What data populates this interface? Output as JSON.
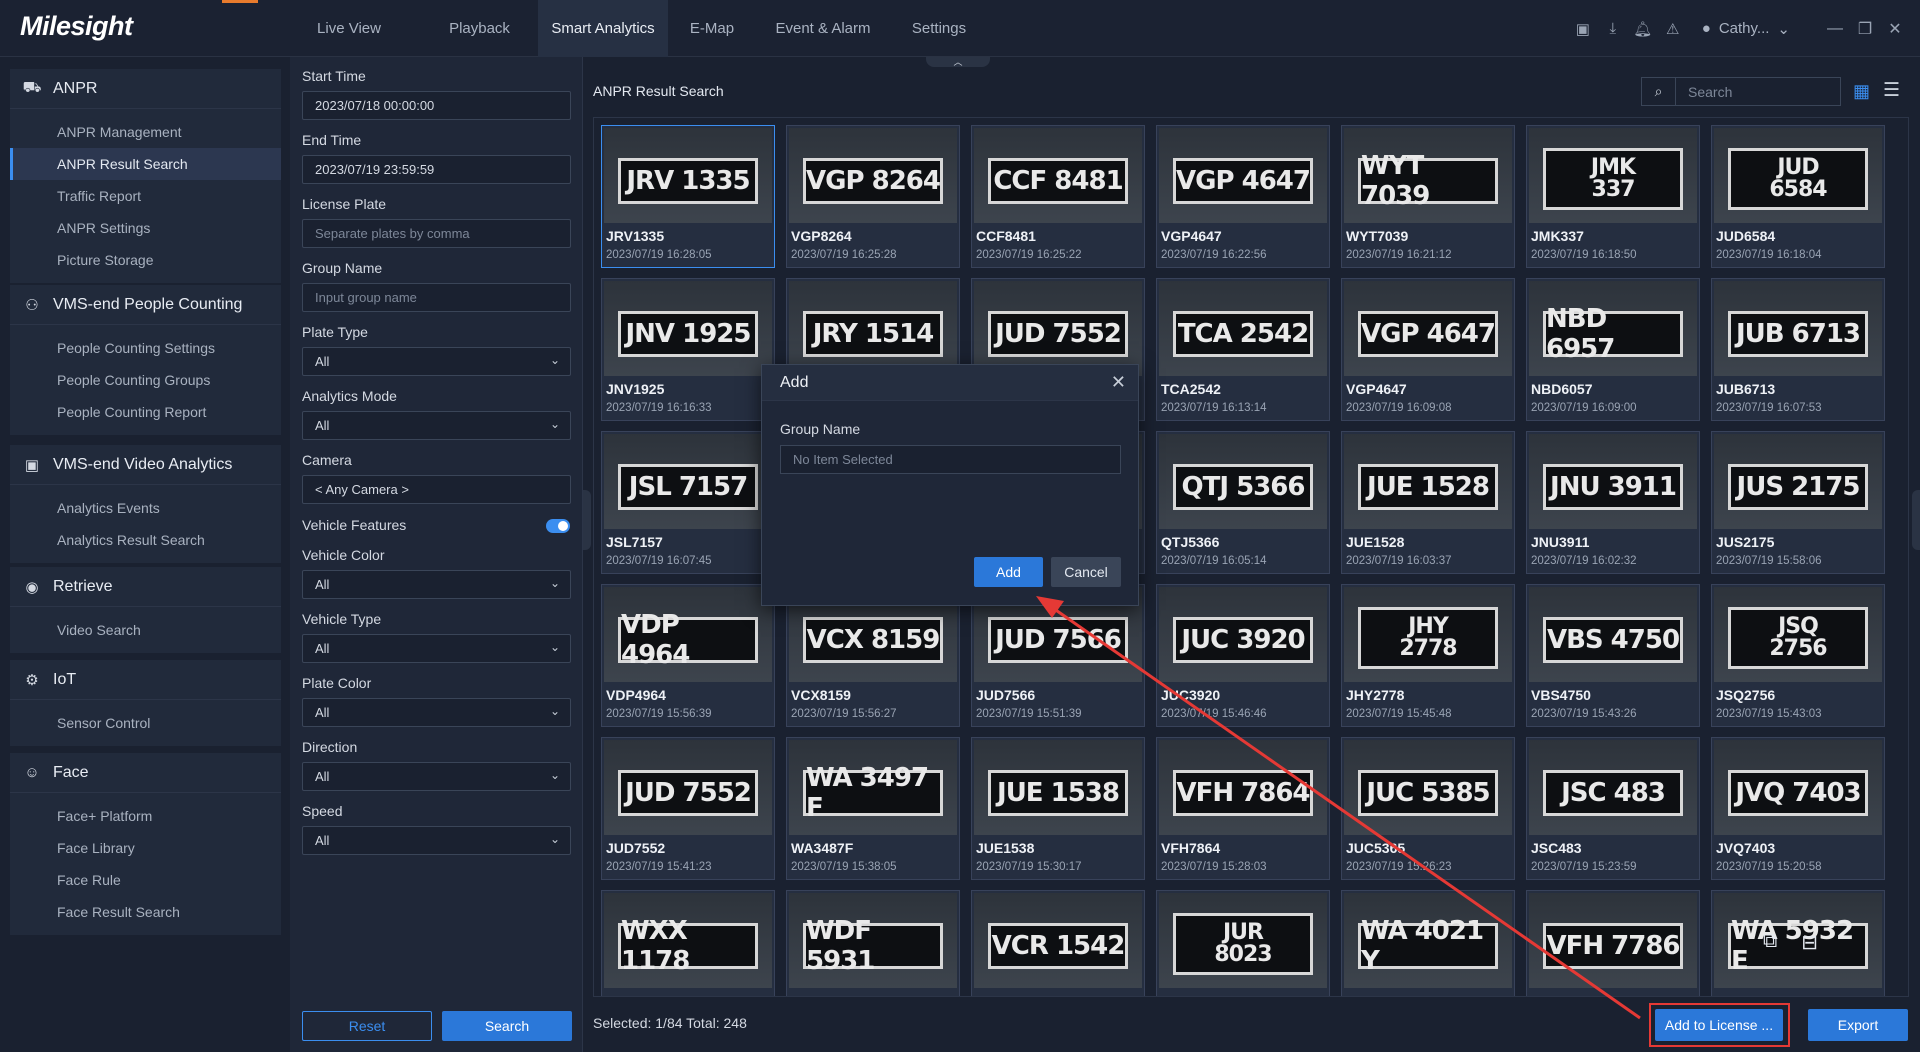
{
  "app": {
    "logo": "Milesight",
    "nav": [
      "Live View",
      "Playback",
      "Smart Analytics",
      "E-Map",
      "Event & Alarm",
      "Settings"
    ],
    "active_nav": "Smart Analytics",
    "user": "Cathy..."
  },
  "sidebar": {
    "sections": [
      {
        "title": "ANPR",
        "icon": "car-icon",
        "items": [
          "ANPR Management",
          "ANPR Result Search",
          "Traffic Report",
          "ANPR Settings",
          "Picture Storage"
        ]
      },
      {
        "title": "VMS-end People Counting",
        "icon": "people-icon",
        "items": [
          "People Counting Settings",
          "People Counting Groups",
          "People Counting Report"
        ]
      },
      {
        "title": "VMS-end Video Analytics",
        "icon": "ai-icon",
        "items": [
          "Analytics Events",
          "Analytics Result Search"
        ]
      },
      {
        "title": "Retrieve",
        "icon": "retrieve-icon",
        "items": [
          "Video Search"
        ]
      },
      {
        "title": "IoT",
        "icon": "iot-icon",
        "items": [
          "Sensor Control"
        ]
      },
      {
        "title": "Face",
        "icon": "face-icon",
        "items": [
          "Face+ Platform",
          "Face Library",
          "Face Rule",
          "Face Result Search"
        ]
      }
    ],
    "active_item": "ANPR Result Search"
  },
  "filters": {
    "start_time_label": "Start Time",
    "start_time": "2023/07/18 00:00:00",
    "end_time_label": "End Time",
    "end_time": "2023/07/19 23:59:59",
    "plate_label": "License Plate",
    "plate_placeholder": "Separate plates by comma",
    "group_label": "Group Name",
    "group_placeholder": "Input group name",
    "plate_type_label": "Plate Type",
    "plate_type": "All",
    "analytics_mode_label": "Analytics Mode",
    "analytics_mode": "All",
    "camera_label": "Camera",
    "camera": "< Any Camera >",
    "vehicle_features_label": "Vehicle Features",
    "vehicle_features_on": true,
    "vehicle_color_label": "Vehicle Color",
    "vehicle_color": "All",
    "vehicle_type_label": "Vehicle Type",
    "vehicle_type": "All",
    "plate_color_label": "Plate Color",
    "plate_color": "All",
    "direction_label": "Direction",
    "direction": "All",
    "speed_label": "Speed",
    "speed": "All",
    "reset": "Reset",
    "search": "Search"
  },
  "main": {
    "title": "ANPR Result Search",
    "search_placeholder": "Search",
    "footer": "Selected: 1/84  Total: 248",
    "add_to_license": "Add to License ...",
    "export": "Export"
  },
  "results": [
    {
      "plate": "JRV1335",
      "display": "JRV 1335",
      "time": "2023/07/19 16:28:05",
      "selected": true
    },
    {
      "plate": "VGP8264",
      "display": "VGP 8264",
      "time": "2023/07/19 16:25:28"
    },
    {
      "plate": "CCF8481",
      "display": "CCF 8481",
      "time": "2023/07/19 16:25:22"
    },
    {
      "plate": "VGP4647",
      "display": "VGP 4647",
      "time": "2023/07/19 16:22:56"
    },
    {
      "plate": "WYT7039",
      "display": "WYT 7039",
      "time": "2023/07/19 16:21:12"
    },
    {
      "plate": "JMK337",
      "display": "JMK|337",
      "time": "2023/07/19 16:18:50"
    },
    {
      "plate": "JUD6584",
      "display": "JUD|6584",
      "time": "2023/07/19 16:18:04"
    },
    {
      "plate": "JNV1925",
      "display": "JNV 1925",
      "time": "2023/07/19 16:16:33"
    },
    {
      "plate": "",
      "display": "JRY 1514",
      "time": ""
    },
    {
      "plate": "",
      "display": "JUD 7552",
      "time": ""
    },
    {
      "plate": "TCA2542",
      "display": "TCA 2542",
      "time": "2023/07/19 16:13:14"
    },
    {
      "plate": "VGP4647",
      "display": "VGP 4647",
      "time": "2023/07/19 16:09:08"
    },
    {
      "plate": "NBD6057",
      "display": "NBD 6957",
      "time": "2023/07/19 16:09:00"
    },
    {
      "plate": "JUB6713",
      "display": "JUB 6713",
      "time": "2023/07/19 16:07:53"
    },
    {
      "plate": "JSL7157",
      "display": "JSL 7157",
      "time": "2023/07/19 16:07:45"
    },
    {
      "plate": "",
      "display": "",
      "time": ""
    },
    {
      "plate": "",
      "display": "",
      "time": ""
    },
    {
      "plate": "QTJ5366",
      "display": "QTJ 5366",
      "time": "2023/07/19 16:05:14"
    },
    {
      "plate": "JUE1528",
      "display": "JUE 1528",
      "time": "2023/07/19 16:03:37"
    },
    {
      "plate": "JNU3911",
      "display": "JNU 3911",
      "time": "2023/07/19 16:02:32"
    },
    {
      "plate": "JUS2175",
      "display": "JUS 2175",
      "time": "2023/07/19 15:58:06"
    },
    {
      "plate": "VDP4964",
      "display": "VDP 4964",
      "time": "2023/07/19 15:56:39"
    },
    {
      "plate": "VCX8159",
      "display": "VCX 8159",
      "time": "2023/07/19 15:56:27"
    },
    {
      "plate": "JUD7566",
      "display": "JUD 7566",
      "time": "2023/07/19 15:51:39"
    },
    {
      "plate": "JUC3920",
      "display": "JUC 3920",
      "time": "2023/07/19 15:46:46"
    },
    {
      "plate": "JHY2778",
      "display": "JHY|2778",
      "time": "2023/07/19 15:45:48"
    },
    {
      "plate": "VBS4750",
      "display": "VBS 4750",
      "time": "2023/07/19 15:43:26"
    },
    {
      "plate": "JSQ2756",
      "display": "JSQ|2756",
      "time": "2023/07/19 15:43:03"
    },
    {
      "plate": "JUD7552",
      "display": "JUD 7552",
      "time": "2023/07/19 15:41:23"
    },
    {
      "plate": "WA3487F",
      "display": "WA 3497 F",
      "time": "2023/07/19 15:38:05"
    },
    {
      "plate": "JUE1538",
      "display": "JUE 1538",
      "time": "2023/07/19 15:30:17"
    },
    {
      "plate": "VFH7864",
      "display": "VFH 7864",
      "time": "2023/07/19 15:28:03"
    },
    {
      "plate": "JUC5365",
      "display": "JUC 5385",
      "time": "2023/07/19 15:26:23"
    },
    {
      "plate": "JSC483",
      "display": "JSC 483",
      "time": "2023/07/19 15:23:59"
    },
    {
      "plate": "JVQ7403",
      "display": "JVQ 7403",
      "time": "2023/07/19 15:20:58"
    },
    {
      "plate": "",
      "display": "WXX 1178",
      "time": ""
    },
    {
      "plate": "",
      "display": "WDF 5931",
      "time": ""
    },
    {
      "plate": "",
      "display": "VCR 1542",
      "time": ""
    },
    {
      "plate": "",
      "display": "JUR|8023",
      "time": ""
    },
    {
      "plate": "",
      "display": "WA 4021 Y",
      "time": ""
    },
    {
      "plate": "",
      "display": "VFH 7786",
      "time": ""
    },
    {
      "plate": "",
      "display": "WA 5932 E",
      "time": ""
    }
  ],
  "dialog": {
    "title": "Add",
    "group_label": "Group Name",
    "group_placeholder": "No Item Selected",
    "add": "Add",
    "cancel": "Cancel"
  },
  "colors": {
    "accent": "#2b78d9",
    "annotation": "#e53935",
    "brand_orange": "#e87b2d"
  }
}
